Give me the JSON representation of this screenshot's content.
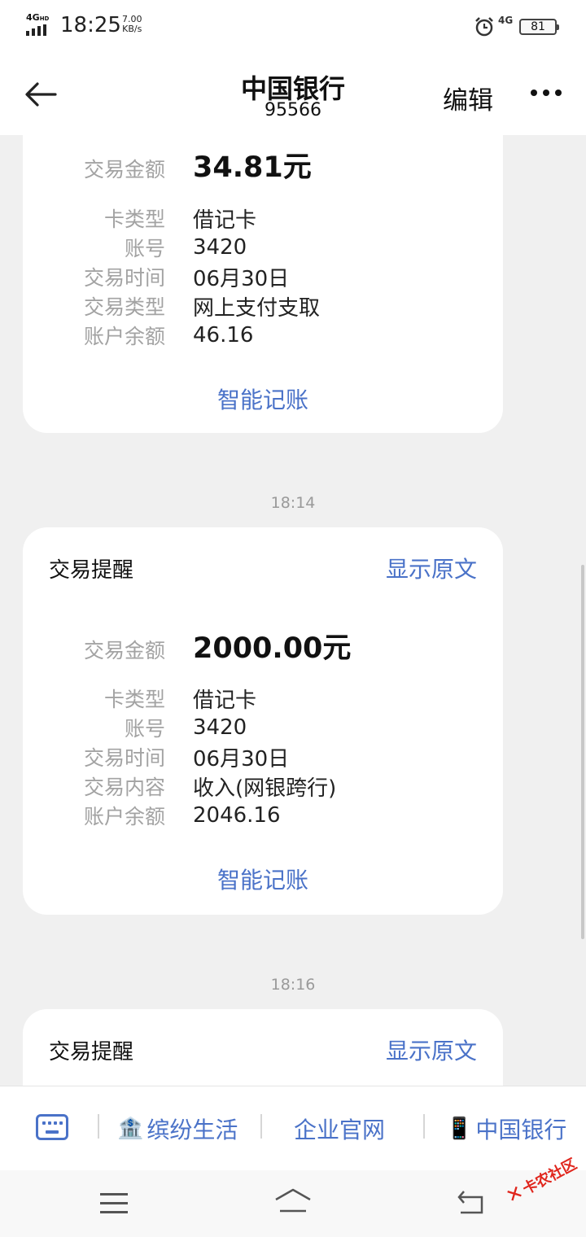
{
  "status_bar": {
    "network_type": "4G",
    "network_sub": "HD",
    "time": "18:25",
    "speed_value": "7.00",
    "speed_unit": "KB/s",
    "mobile_data": "4G",
    "battery": "81"
  },
  "header": {
    "title": "中国银行",
    "subtitle": "95566",
    "edit_label": "编辑"
  },
  "messages": [
    {
      "amount_label": "交易金额",
      "amount": "34.81元",
      "details": [
        {
          "label": "卡类型",
          "value": "借记卡"
        },
        {
          "label": "账号",
          "value": "3420"
        },
        {
          "label": "交易时间",
          "value": "06月30日"
        },
        {
          "label": "交易类型",
          "value": "网上支付支取"
        },
        {
          "label": "账户余额",
          "value": "46.16"
        }
      ],
      "action": "智能记账"
    },
    {
      "timestamp": "18:14",
      "title": "交易提醒",
      "show_original": "显示原文",
      "amount_label": "交易金额",
      "amount": "2000.00元",
      "details": [
        {
          "label": "卡类型",
          "value": "借记卡"
        },
        {
          "label": "账号",
          "value": "3420"
        },
        {
          "label": "交易时间",
          "value": "06月30日"
        },
        {
          "label": "交易内容",
          "value": "收入(网银跨行)"
        },
        {
          "label": "账户余额",
          "value": "2046.16"
        }
      ],
      "action": "智能记账"
    },
    {
      "timestamp": "18:16",
      "title": "交易提醒",
      "show_original": "显示原文"
    }
  ],
  "bottom_menu": {
    "items": [
      {
        "label": "缤纷生活",
        "icon": "bank-icon"
      },
      {
        "label": "企业官网"
      },
      {
        "label": "中国银行",
        "icon": "phone-icon"
      }
    ]
  },
  "watermark": "卡农社区",
  "colors": {
    "link": "#4a72c8",
    "background": "#f0f0f0",
    "card": "#ffffff",
    "label_gray": "#a3a3a3"
  }
}
